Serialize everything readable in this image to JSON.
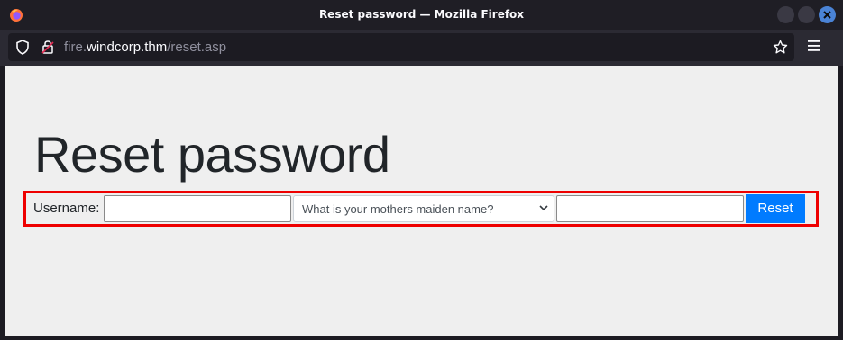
{
  "window": {
    "title": "Reset password — Mozilla Firefox",
    "app_icon": "firefox-icon"
  },
  "urlbar": {
    "url_prefix": "fire.",
    "url_host": "windcorp.thm",
    "url_path": "/reset.asp",
    "icons": [
      "shield-icon",
      "permissions-lock-icon",
      "bookmark-star-icon"
    ]
  },
  "toolbar": {
    "menu_icon": "hamburger-menu-icon"
  },
  "page": {
    "title": "Reset password",
    "form": {
      "username_label": "Username:",
      "username_value": "",
      "question_selected": "What is your mothers maiden name?",
      "answer_value": "",
      "reset_label": "Reset"
    }
  },
  "colors": {
    "accent": "#007bff",
    "highlight": "#ee0000",
    "page_bg": "#efefef"
  }
}
